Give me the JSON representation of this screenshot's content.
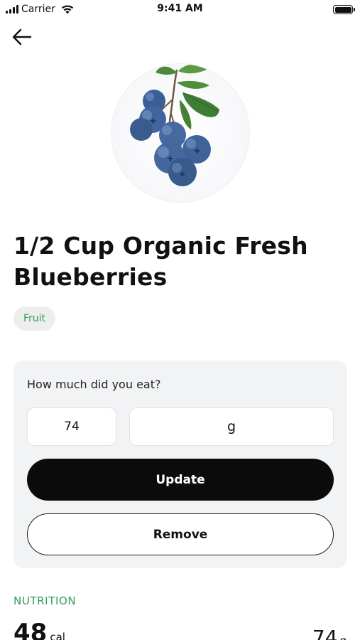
{
  "status_bar": {
    "carrier": "Carrier",
    "time": "9:41 AM",
    "icons": [
      "signal-icon",
      "wifi-icon",
      "battery-icon"
    ]
  },
  "nav": {
    "back_icon": "arrow-left-icon"
  },
  "product": {
    "title": "1/2 Cup Organic Fresh Blueberries",
    "category": "Fruit",
    "image": "blueberries-image"
  },
  "serving": {
    "question": "How much did you eat?",
    "quantity": "74",
    "unit": "g",
    "update_label": "Update",
    "remove_label": "Remove"
  },
  "nutrition": {
    "heading": "NUTRITION",
    "calories": "48",
    "calories_unit": "cal",
    "weight": "74",
    "weight_unit": "g"
  },
  "colors": {
    "accent_green": "#2e9e5b",
    "primary_button": "#0b0b0b",
    "card_background": "#f2f3f5",
    "badge_background": "#eeeeee"
  }
}
